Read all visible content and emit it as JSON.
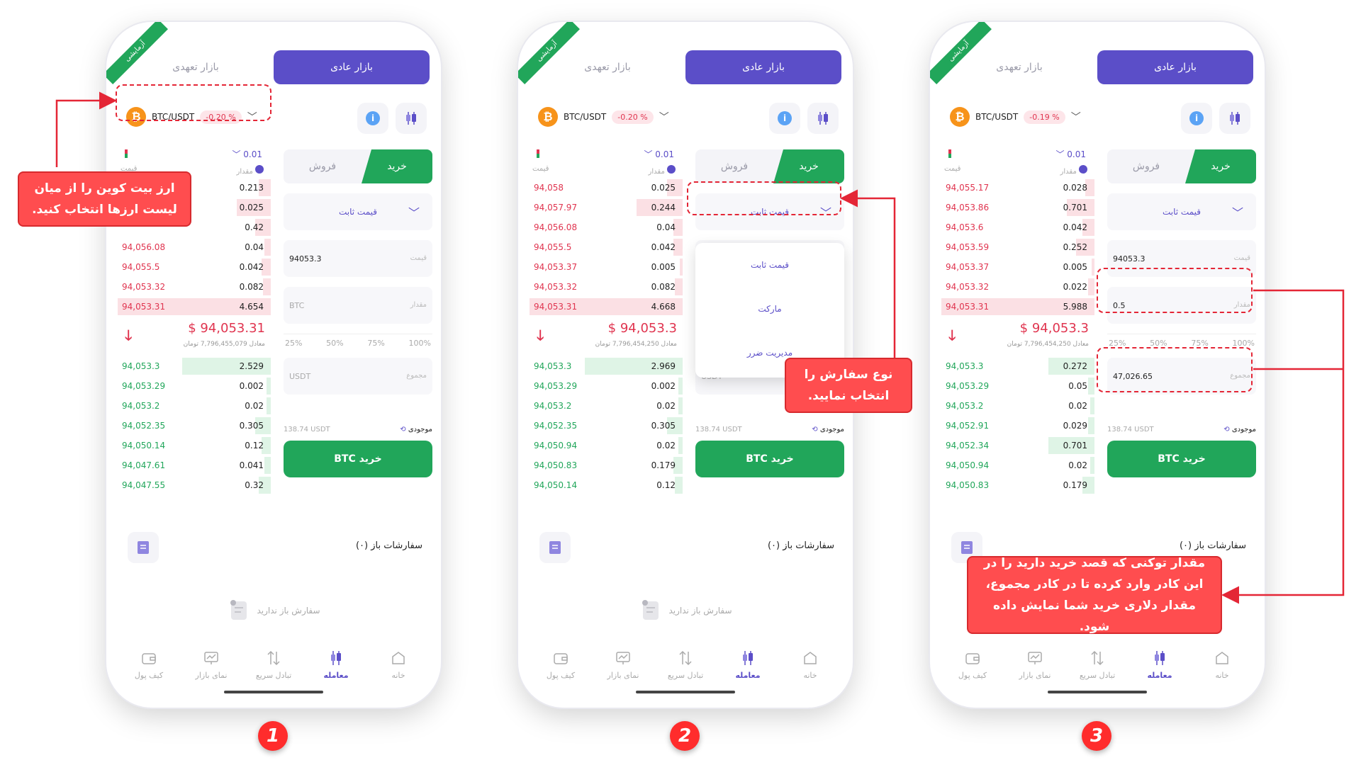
{
  "common": {
    "demo": "آزمایشی",
    "future_market": "بازار تعهدی",
    "spot_market": "بازار عادی",
    "pair": "BTC/USDT",
    "btc_symbol": "₿",
    "info_symbol": "i",
    "step": "0.01",
    "price_label": "قیمت",
    "amount_label": "مقدار",
    "sell": "فروش",
    "buy": "خرید",
    "order_type": "قیمت ثابت",
    "price_field_label": "قیمت",
    "amount_field_label": "مقدار",
    "total_field_label": "مجموع",
    "btc_placeholder": "BTC",
    "usdt_placeholder": "USDT",
    "percents": [
      "25%",
      "50%",
      "75%",
      "100%"
    ],
    "balance_value": "138.74 USDT",
    "balance_label": "موجودی",
    "buy_button": "خرید BTC",
    "open_orders": "سفارشات باز (۰)",
    "no_orders": "سفارش باز ندارید",
    "nav": [
      "خانه",
      "معامله",
      "تبادل سریع",
      "نمای بازار",
      "کیف پول"
    ],
    "dropdown_options": [
      "قیمت ثابت",
      "مارکت",
      "مدیریت ضرر"
    ]
  },
  "phones": [
    {
      "change": "-0.20 %",
      "price_value": "94053.3",
      "amount_value": "",
      "total_value": "",
      "mid_price": "$ 94,053.31",
      "mid_toman": "معادل 7,796,455,079 تومان",
      "asks": [
        {
          "p": "",
          "a": "0.213"
        },
        {
          "p": "",
          "a": "0.025"
        },
        {
          "p": "",
          "a": "0.42"
        },
        {
          "p": "94,056.08",
          "a": "0.04"
        },
        {
          "p": "94,055.5",
          "a": "0.042"
        },
        {
          "p": "94,053.32",
          "a": "0.082"
        },
        {
          "p": "94,053.31",
          "a": "4.654"
        }
      ],
      "bids": [
        {
          "p": "94,053.3",
          "a": "2.529"
        },
        {
          "p": "94,053.29",
          "a": "0.002"
        },
        {
          "p": "94,053.2",
          "a": "0.02"
        },
        {
          "p": "94,052.35",
          "a": "0.305"
        },
        {
          "p": "94,050.14",
          "a": "0.12"
        },
        {
          "p": "94,047.61",
          "a": "0.041"
        },
        {
          "p": "94,047.55",
          "a": "0.32"
        }
      ]
    },
    {
      "change": "-0.20 %",
      "price_value": "",
      "amount_value": "",
      "total_value": "",
      "mid_price": "$ 94,053.3",
      "mid_toman": "معادل 7,796,454,250 تومان",
      "asks": [
        {
          "p": "94,058",
          "a": "0.025"
        },
        {
          "p": "94,057.97",
          "a": "0.244"
        },
        {
          "p": "94,056.08",
          "a": "0.04"
        },
        {
          "p": "94,055.5",
          "a": "0.042"
        },
        {
          "p": "94,053.37",
          "a": "0.005"
        },
        {
          "p": "94,053.32",
          "a": "0.082"
        },
        {
          "p": "94,053.31",
          "a": "4.668"
        }
      ],
      "bids": [
        {
          "p": "94,053.3",
          "a": "2.969"
        },
        {
          "p": "94,053.29",
          "a": "0.002"
        },
        {
          "p": "94,053.2",
          "a": "0.02"
        },
        {
          "p": "94,052.35",
          "a": "0.305"
        },
        {
          "p": "94,050.94",
          "a": "0.02"
        },
        {
          "p": "94,050.83",
          "a": "0.179"
        },
        {
          "p": "94,050.14",
          "a": "0.12"
        }
      ]
    },
    {
      "change": "-0.19 %",
      "price_value": "94053.3",
      "amount_value": "0.5",
      "total_value": "47,026.65",
      "mid_price": "$ 94,053.3",
      "mid_toman": "معادل 7,796,454,250 تومان",
      "asks": [
        {
          "p": "94,055.17",
          "a": "0.028"
        },
        {
          "p": "94,053.86",
          "a": "0.701"
        },
        {
          "p": "94,053.6",
          "a": "0.042"
        },
        {
          "p": "94,053.59",
          "a": "0.252"
        },
        {
          "p": "94,053.37",
          "a": "0.005"
        },
        {
          "p": "94,053.32",
          "a": "0.022"
        },
        {
          "p": "94,053.31",
          "a": "5.988"
        }
      ],
      "bids": [
        {
          "p": "94,053.3",
          "a": "0.272"
        },
        {
          "p": "94,053.29",
          "a": "0.05"
        },
        {
          "p": "94,053.2",
          "a": "0.02"
        },
        {
          "p": "94,052.91",
          "a": "0.029"
        },
        {
          "p": "94,052.34",
          "a": "0.701"
        },
        {
          "p": "94,050.94",
          "a": "0.02"
        },
        {
          "p": "94,050.83",
          "a": "0.179"
        }
      ]
    }
  ],
  "callouts": {
    "c1": "ارز بیت کوین را از میان لیست ارزها انتخاب کنید.",
    "c2": "نوع سفارش را انتخاب نمایید.",
    "c3": "مقدار توکنی که قصد خرید دارید را در این کادر وارد کرده تا در کادر مجموع، مقدار دلاری خرید شما نمایش داده شود."
  },
  "steps": [
    "1",
    "2",
    "3"
  ],
  "colors": {
    "purple": "#5b4ec8",
    "green": "#21a65a",
    "red": "#e0344f",
    "callout": "#ff4d4f"
  }
}
